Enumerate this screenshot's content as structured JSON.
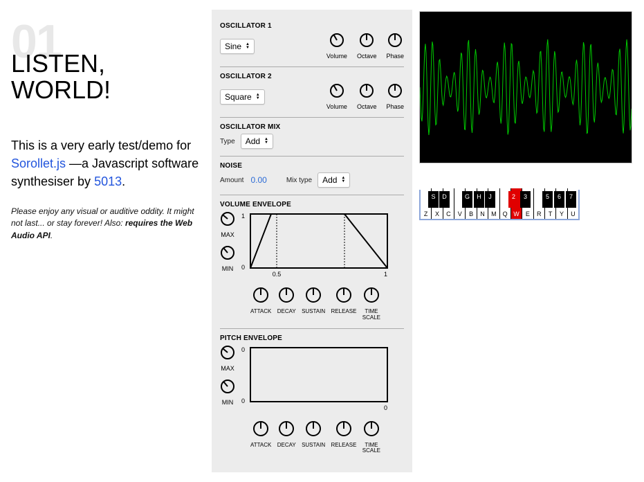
{
  "header": {
    "number": "01",
    "headline": "LISTEN, WORLD!",
    "intro_pre": "This is a very early test/demo for ",
    "intro_link1": "Sorollet.js",
    "intro_mid": " —a Javascript software synthesiser by ",
    "intro_link2": "5013",
    "intro_end": ".",
    "note_pre": "Please enjoy any visual or auditive oddity. It might not last... or stay forever! Also: ",
    "note_bold": "requires the Web Audio API",
    "note_end": "."
  },
  "panel": {
    "osc1": {
      "title": "OSCILLATOR 1",
      "wave": "Sine",
      "knobs": [
        "Volume",
        "Octave",
        "Phase"
      ]
    },
    "osc2": {
      "title": "OSCILLATOR 2",
      "wave": "Square",
      "knobs": [
        "Volume",
        "Octave",
        "Phase"
      ]
    },
    "mix": {
      "title": "OSCILLATOR MIX",
      "type_label": "Type",
      "type_value": "Add"
    },
    "noise": {
      "title": "NOISE",
      "amount_label": "Amount",
      "amount_value": "0.00",
      "mixtype_label": "Mix type",
      "mixtype_value": "Add"
    },
    "vol_env": {
      "title": "VOLUME ENVELOPE",
      "max_label": "MAX",
      "min_label": "MIN",
      "y_top": "1",
      "y_bot": "0",
      "x_mid": "0.5",
      "x_right": "1",
      "knobs": [
        "ATTACK",
        "DECAY",
        "SUSTAIN",
        "RELEASE",
        "TIME\nSCALE"
      ]
    },
    "pitch_env": {
      "title": "PITCH ENVELOPE",
      "max_label": "MAX",
      "min_label": "MIN",
      "y_top": "0",
      "y_bot": "0",
      "x_right": "0",
      "knobs": [
        "ATTACK",
        "DECAY",
        "SUSTAIN",
        "RELEASE",
        "TIME\nSCALE"
      ]
    }
  },
  "keyboard": {
    "white_keys": [
      "Z",
      "X",
      "C",
      "V",
      "B",
      "N",
      "M",
      "Q",
      "W",
      "E",
      "R",
      "T",
      "Y",
      "U"
    ],
    "black_keys": [
      {
        "label": "S",
        "pos": 11
      },
      {
        "label": "D",
        "pos": 27
      },
      {
        "label": "G",
        "pos": 60
      },
      {
        "label": "H",
        "pos": 77
      },
      {
        "label": "J",
        "pos": 93
      },
      {
        "label": "2",
        "pos": 127
      },
      {
        "label": "3",
        "pos": 144
      },
      {
        "label": "5",
        "pos": 176
      },
      {
        "label": "6",
        "pos": 193
      },
      {
        "label": "7",
        "pos": 210
      }
    ],
    "pressed_white_index": 8,
    "pressed_black_index": 5
  }
}
